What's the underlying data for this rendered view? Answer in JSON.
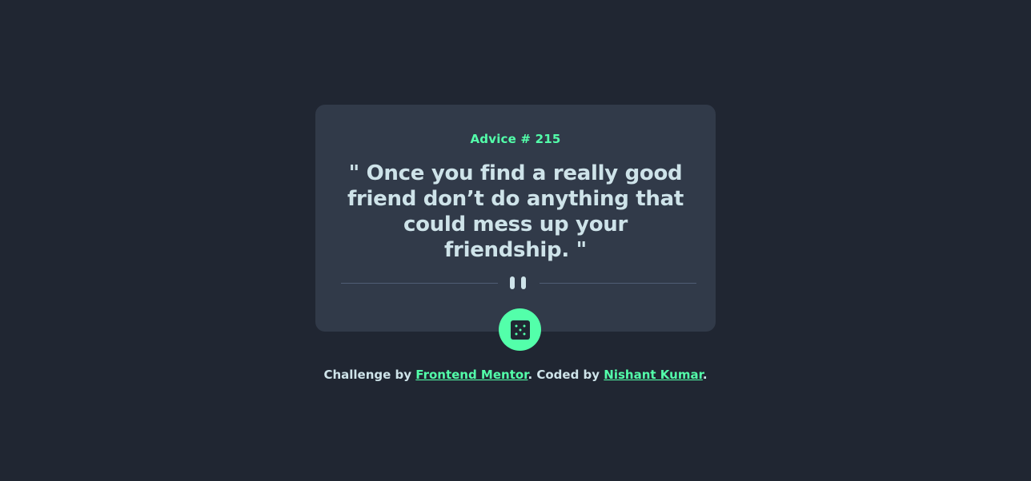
{
  "card": {
    "advice_label": "Advice # 215",
    "quote": "\" Once you find a really good friend don’t do anything that could mess up your friendship. \""
  },
  "dice_button": {
    "icon": "dice-icon"
  },
  "attribution": {
    "prefix": "Challenge by ",
    "link1": "Frontend Mentor",
    "middle": ". Coded by ",
    "link2": "Nishant Kumar",
    "suffix": "."
  },
  "colors": {
    "background": "#202632",
    "card": "#313a49",
    "accent": "#53ffaa",
    "text": "#cee3e9",
    "divider": "#4f5d74"
  }
}
